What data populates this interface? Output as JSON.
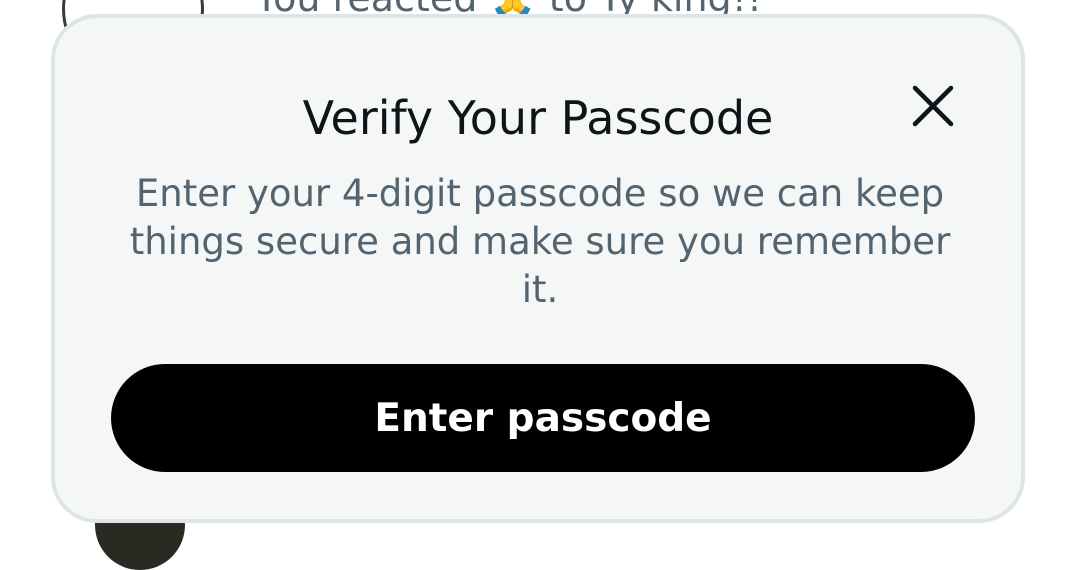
{
  "background": {
    "notification_text": "You reacted 🙏 to Ty king!!"
  },
  "dialog": {
    "title": "Verify Your Passcode",
    "description": "Enter your 4-digit passcode so we can keep things secure and make sure you remember it.",
    "primary_button_label": "Enter passcode",
    "close_icon": "close-icon"
  },
  "colors": {
    "modal_background": "#f5f7f7",
    "modal_border": "#dde5e6",
    "title": "#0f1419",
    "secondary_text": "#536471",
    "button_background": "#000000",
    "button_text": "#ffffff"
  }
}
